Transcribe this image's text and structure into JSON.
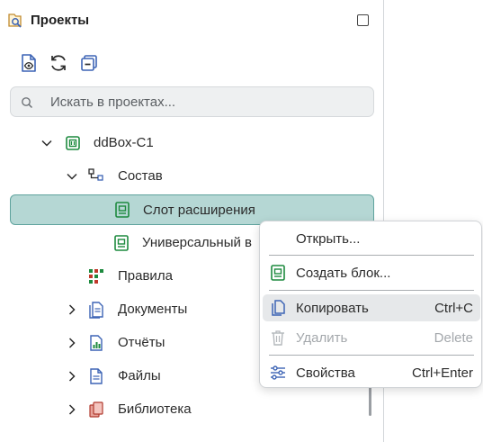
{
  "panel": {
    "title": "Проекты"
  },
  "search": {
    "placeholder": "Искать в проектах..."
  },
  "tree": {
    "root": "ddBox-C1",
    "composition": "Состав",
    "slot": "Слот расширения",
    "universal": "Универсальный в",
    "rules": "Правила",
    "documents": "Документы",
    "reports": "Отчёты",
    "files": "Файлы",
    "library": "Библиотека"
  },
  "context_menu": {
    "open": "Открыть...",
    "create_block": "Создать блок...",
    "copy": "Копировать",
    "copy_shortcut": "Ctrl+C",
    "delete": "Удалить",
    "delete_shortcut": "Delete",
    "properties": "Свойства",
    "properties_shortcut": "Ctrl+Enter"
  },
  "colors": {
    "selection_bg": "#b5d7d4",
    "selection_border": "#5fa39e",
    "green_icon": "#1d8a3e",
    "blue_icon": "#3d64b5"
  }
}
